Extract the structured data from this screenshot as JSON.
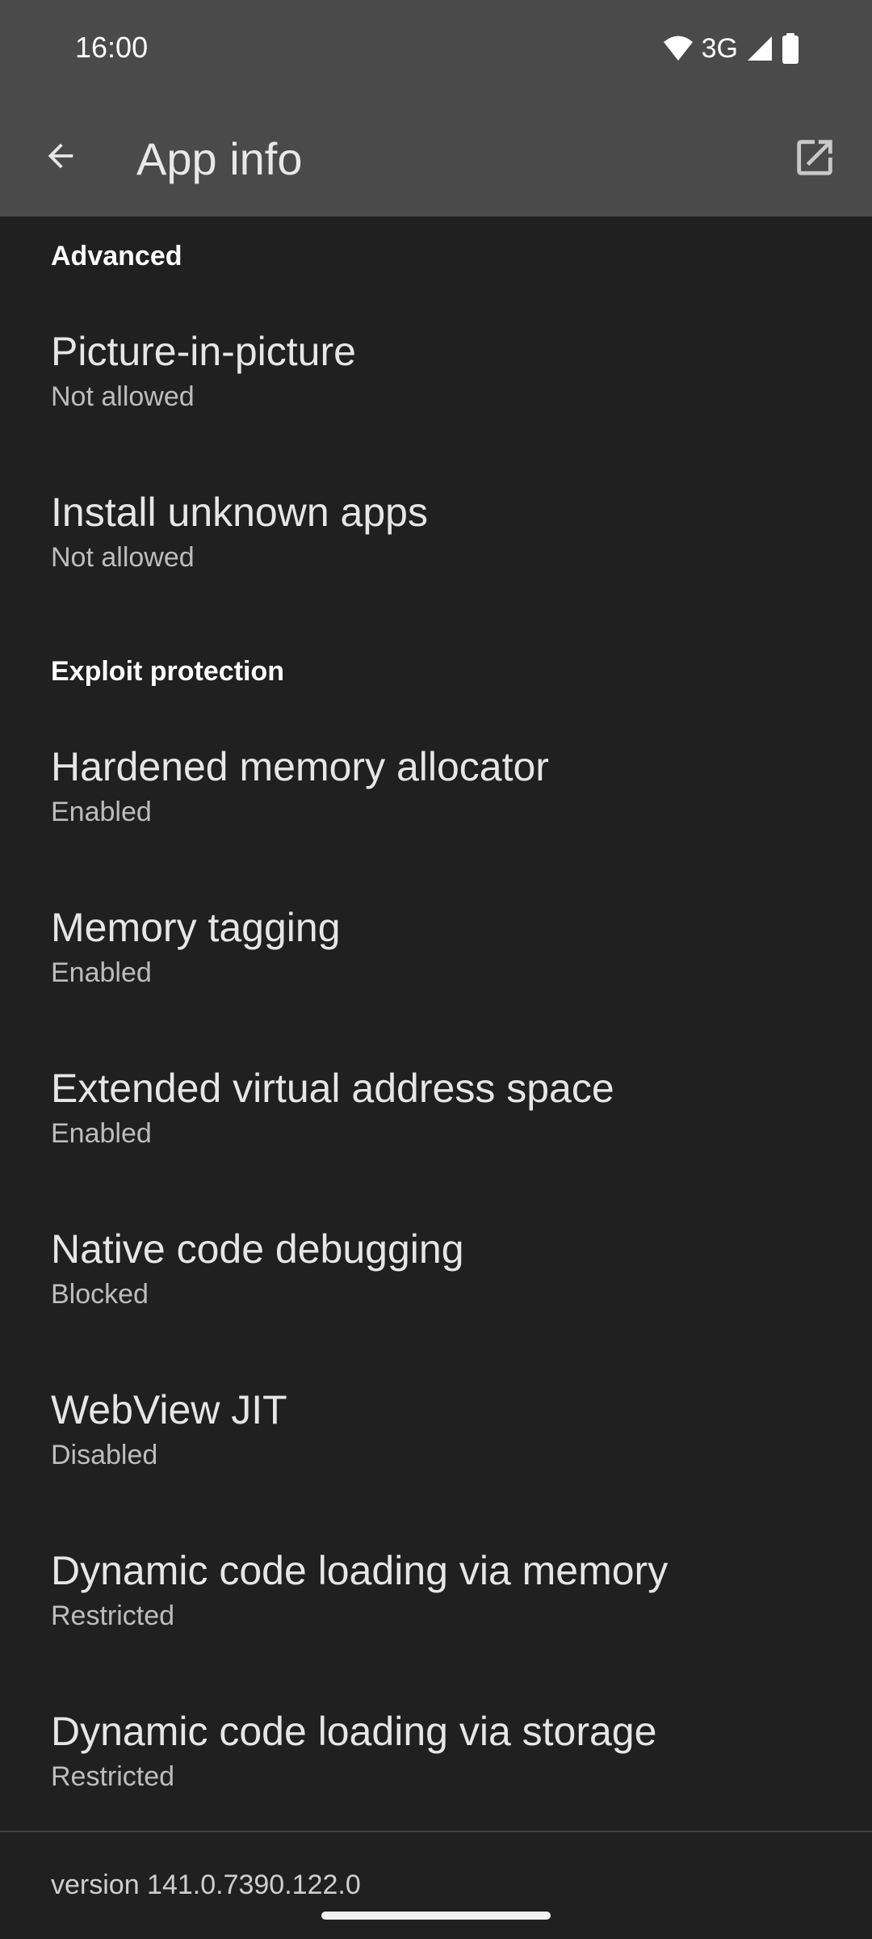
{
  "status_bar": {
    "time": "16:00",
    "network": "3G",
    "icons": [
      "wifi-icon",
      "cellular-signal-icon",
      "battery-icon"
    ]
  },
  "app_bar": {
    "title": "App info",
    "back_icon": "arrow-back-icon",
    "action_icon": "open-in-new-icon"
  },
  "sections": {
    "advanced": {
      "title": "Advanced",
      "items": [
        {
          "title": "Picture-in-picture",
          "summary": "Not allowed"
        },
        {
          "title": "Install unknown apps",
          "summary": "Not allowed"
        }
      ]
    },
    "exploit": {
      "title": "Exploit protection",
      "items": [
        {
          "title": "Hardened memory allocator",
          "summary": "Enabled"
        },
        {
          "title": "Memory tagging",
          "summary": "Enabled"
        },
        {
          "title": "Extended virtual address space",
          "summary": "Enabled"
        },
        {
          "title": "Native code debugging",
          "summary": "Blocked"
        },
        {
          "title": "WebView JIT",
          "summary": "Disabled"
        },
        {
          "title": "Dynamic code loading via memory",
          "summary": "Restricted"
        },
        {
          "title": "Dynamic code loading via storage",
          "summary": "Restricted"
        }
      ]
    }
  },
  "footer": {
    "version": "version 141.0.7390.122.0"
  },
  "colors": {
    "background": "#202020",
    "app_bar": "#4a4a4a",
    "primary_text": "#e6e6e6",
    "secondary_text": "#bdbdbd"
  }
}
